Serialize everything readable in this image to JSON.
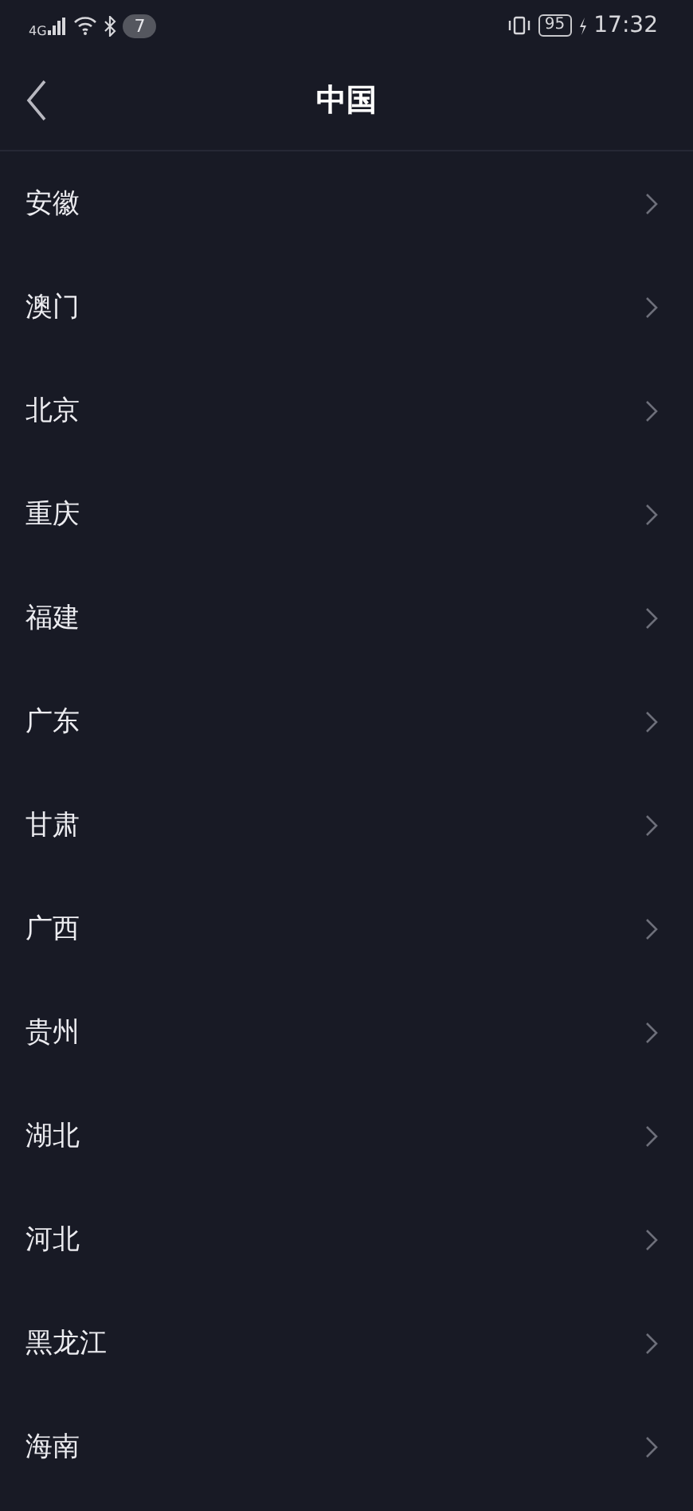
{
  "status_bar": {
    "network": "4G",
    "notification_count": "7",
    "battery": "95",
    "time": "17:32"
  },
  "header": {
    "title": "中国"
  },
  "regions": [
    {
      "name": "安徽"
    },
    {
      "name": "澳门"
    },
    {
      "name": "北京"
    },
    {
      "name": "重庆"
    },
    {
      "name": "福建"
    },
    {
      "name": "广东"
    },
    {
      "name": "甘肃"
    },
    {
      "name": "广西"
    },
    {
      "name": "贵州"
    },
    {
      "name": "湖北"
    },
    {
      "name": "河北"
    },
    {
      "name": "黑龙江"
    },
    {
      "name": "海南"
    }
  ]
}
